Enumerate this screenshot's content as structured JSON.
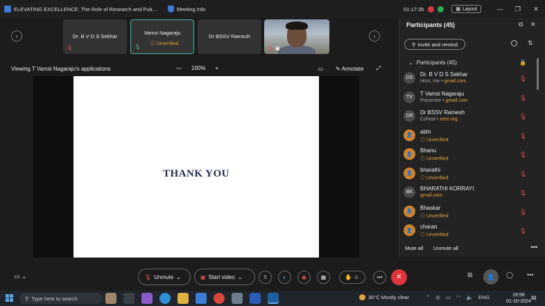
{
  "titlebar": {
    "title": "ELEVATING EXCELLENCE: The Role of Research and Publicati...",
    "meeting_info": "Meeting Info",
    "timer": "01:17:35",
    "layout_label": "Layout"
  },
  "strip": {
    "tiles": [
      {
        "name": "Dr. B V D S Sekhar"
      },
      {
        "name": "Vamsi Nagaraju",
        "status": "Unverified"
      },
      {
        "name": "Dr BSSV Ramesh"
      }
    ]
  },
  "viewbar": {
    "viewing": "Viewing T Vamsi Nagaraju's applications",
    "zoom": "100%",
    "annotate": "Annotate"
  },
  "slide": {
    "text": "THANK YOU"
  },
  "panel": {
    "header": "Participants (45)",
    "invite": "Invite and remind",
    "group_label": "Participants (45)",
    "participants": [
      {
        "initials": "DS",
        "name": "Dr. B V D S Sekhar",
        "role": "Host, me",
        "email": "gmail.com"
      },
      {
        "initials": "TV",
        "name": "T Vamsi Nagaraju",
        "role": "Presenter",
        "email": "gmail.com"
      },
      {
        "initials": "DR",
        "name": "Dr BSSV Ramesh",
        "role": "Cohost",
        "email": "ieee.org"
      },
      {
        "name": "abhi",
        "status": "Unverified"
      },
      {
        "name": "Bhanu",
        "status": "Unverified"
      },
      {
        "name": "bharathi",
        "status": "Unverified"
      },
      {
        "initials": "BK",
        "name": "BHARATHI KORRAYI",
        "email": "gmail.com"
      },
      {
        "name": "Bhaskar",
        "status": "Unverified"
      },
      {
        "name": "charan",
        "status": "Unverified"
      }
    ],
    "mute_all": "Mute all",
    "unmute_all": "Unmute all"
  },
  "controls": {
    "unmute": "Unmute",
    "start_video": "Start video"
  },
  "taskbar": {
    "search_placeholder": "Type here to search",
    "weather": "30°C  Mostly clear",
    "lang": "ENG",
    "time": "19:56",
    "date": "01-10-2024"
  },
  "colors": {
    "accent_teal": "#3fb9a8",
    "warning_orange": "#e6a23c",
    "danger_red": "#e0353d"
  }
}
